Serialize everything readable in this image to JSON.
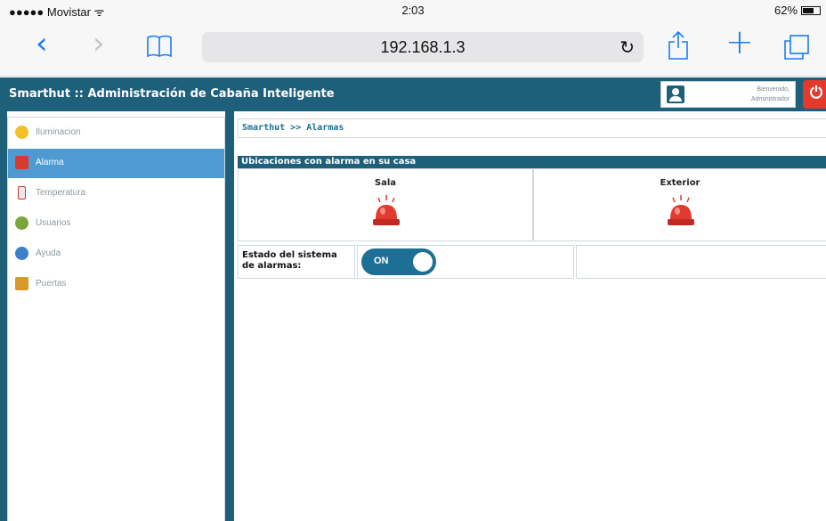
{
  "statusbar": {
    "carrier": "●●●●● Movistar ᯤ",
    "time": "2:03",
    "battery": "62%"
  },
  "browser": {
    "url": "192.168.1.3",
    "reload_icon": "reload-icon"
  },
  "app": {
    "title": "Smarthut :: Administración de Cabaña Inteligente",
    "welcome_line1": "Bienvenido,",
    "welcome_line2": "Administrador",
    "power_icon": "power-icon",
    "accent_color": "#1e5f7a",
    "active_color": "#4f9bd1"
  },
  "sidebar": {
    "items": [
      {
        "label": "Iluminacion",
        "icon": "lightbulb-icon"
      },
      {
        "label": "Alarma",
        "icon": "alarm-icon"
      },
      {
        "label": "Temperatura",
        "icon": "thermometer-icon"
      },
      {
        "label": "Usuarios",
        "icon": "users-icon"
      },
      {
        "label": "Ayuda",
        "icon": "help-icon"
      },
      {
        "label": "Puertas",
        "icon": "door-icon"
      }
    ]
  },
  "main": {
    "breadcrumb": "Smarthut >> Alarmas",
    "section_title": "Ubicaciones con alarma en su casa",
    "locations": [
      {
        "name": "Sala"
      },
      {
        "name": "Exterior"
      }
    ],
    "status_label": "Estado del sistema de alarmas:",
    "toggle_label": "ON"
  }
}
